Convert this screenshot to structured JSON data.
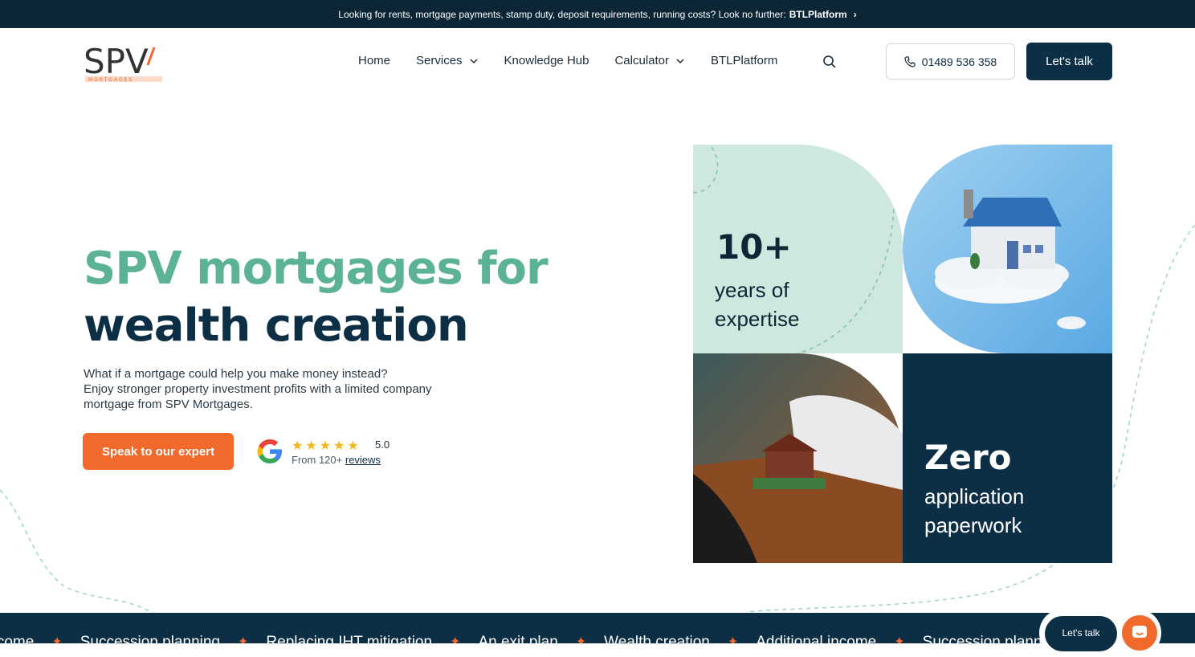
{
  "announcement": {
    "text": "Looking for rents, mortgage payments, stamp duty, deposit requirements, running costs? Look no further:",
    "link": "BTLPlatform"
  },
  "logo": {
    "wordmark": "SPV",
    "tag": "MORTGAGES"
  },
  "nav": {
    "items": [
      {
        "label": "Home",
        "has_dropdown": false
      },
      {
        "label": "Services",
        "has_dropdown": true
      },
      {
        "label": "Knowledge Hub",
        "has_dropdown": false
      },
      {
        "label": "Calculator",
        "has_dropdown": true
      },
      {
        "label": "BTLPlatform",
        "has_dropdown": false
      }
    ],
    "phone": "01489 536 358",
    "cta": "Let's talk"
  },
  "hero": {
    "title_line1": "SPV mortgages for",
    "title_line2": "wealth creation",
    "subtitle_line1": "What if a mortgage could help you make money instead?",
    "subtitle_line2": "Enjoy stronger property investment profits with a limited company mortgage from SPV Mortgages.",
    "cta": "Speak to our expert",
    "rating": {
      "score": "5.0",
      "stars": 5,
      "from_text": "From 120+",
      "link": "reviews"
    }
  },
  "stats": {
    "years_value": "10+",
    "years_label_1": "years of",
    "years_label_2": "expertise",
    "zero_value": "Zero",
    "zero_label_1": "application",
    "zero_label_2": "paperwork"
  },
  "ticker": [
    "Income",
    "Succession planning",
    "Replacing IHT mitigation",
    "An exit plan",
    "Wealth creation",
    "Additional income",
    "Succession planning"
  ],
  "chat": {
    "label": "Let's talk"
  },
  "colors": {
    "navy": "#0c2f45",
    "green": "#5bb394",
    "orange": "#f26a2b",
    "mint": "#cfe8df"
  }
}
